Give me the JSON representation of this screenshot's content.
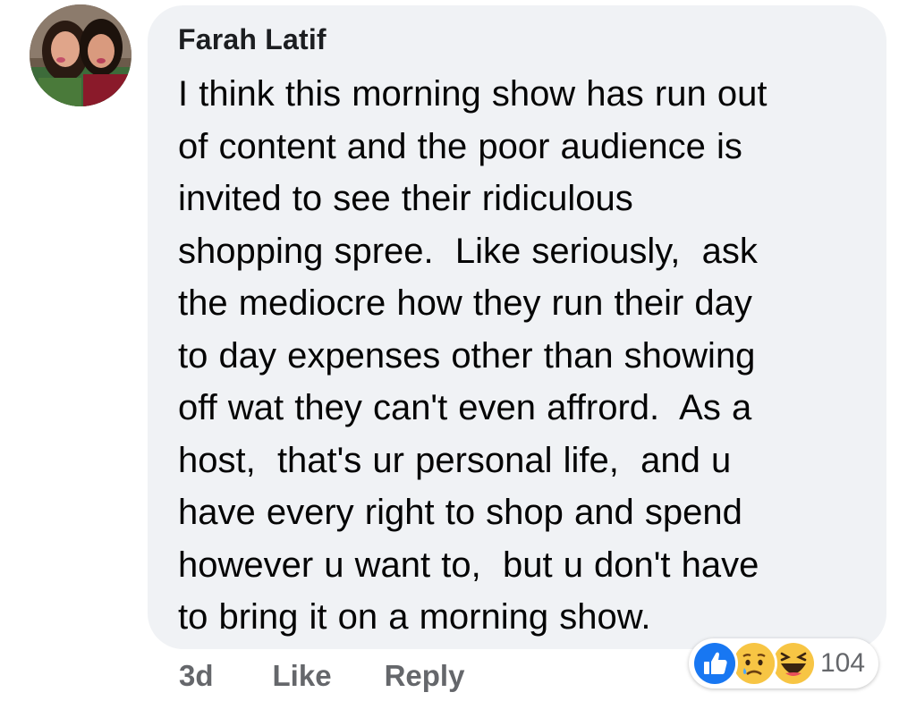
{
  "comment": {
    "author": "Farah Latif",
    "lines": [
      "I think this morning show has run out",
      "of content and the poor audience is",
      "invited to see their ridiculous",
      "shopping spree.  Like seriously,  ask",
      "the mediocre how they run their day",
      "to day expenses other than showing",
      "off wat they can't even affrord.  As a",
      "host,  that's ur personal life,  and u",
      "have every right to shop and spend",
      "however u want to,  but u don't have",
      "to bring it on a morning show."
    ]
  },
  "actions": {
    "timestamp": "3d",
    "like_label": "Like",
    "reply_label": "Reply"
  },
  "reactions": {
    "icons": [
      "like-icon",
      "sad-icon",
      "haha-icon"
    ],
    "count": "104"
  },
  "colors": {
    "bubble": "#f0f2f5",
    "action_text": "#65676b",
    "like_blue": "#1877f2",
    "emoji_yellow": "#f7c544"
  }
}
